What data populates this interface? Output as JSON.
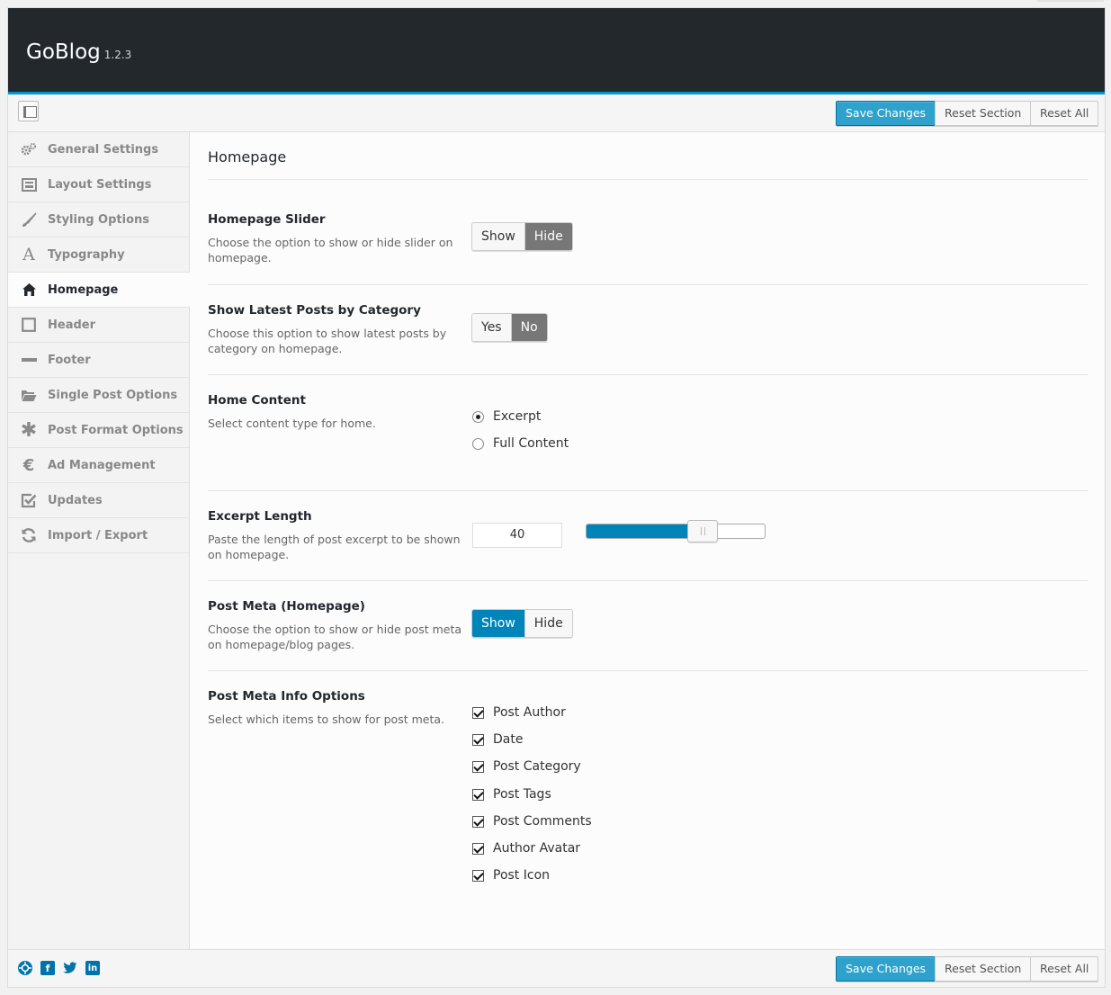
{
  "header": {
    "title": "GoBlog",
    "version": "1.2.3"
  },
  "toolbar": {
    "save_label": "Save Changes",
    "reset_section_label": "Reset Section",
    "reset_all_label": "Reset All"
  },
  "sidebar": {
    "items": [
      {
        "label": "General Settings",
        "icon": "gears-icon"
      },
      {
        "label": "Layout Settings",
        "icon": "layout-icon"
      },
      {
        "label": "Styling Options",
        "icon": "brush-icon"
      },
      {
        "label": "Typography",
        "icon": "font-icon"
      },
      {
        "label": "Homepage",
        "icon": "home-icon"
      },
      {
        "label": "Header",
        "icon": "square-icon"
      },
      {
        "label": "Footer",
        "icon": "minus-icon"
      },
      {
        "label": "Single Post Options",
        "icon": "folder-icon"
      },
      {
        "label": "Post Format Options",
        "icon": "asterisk-icon"
      },
      {
        "label": "Ad Management",
        "icon": "euro-icon"
      },
      {
        "label": "Updates",
        "icon": "checkbox-icon"
      },
      {
        "label": "Import / Export",
        "icon": "refresh-icon"
      }
    ],
    "active": "Homepage"
  },
  "section": {
    "title": "Homepage",
    "slider": {
      "label": "Homepage Slider",
      "desc": "Choose the option to show or hide slider on homepage.",
      "show": "Show",
      "hide": "Hide",
      "selected": "Hide"
    },
    "latest": {
      "label": "Show Latest Posts by Category",
      "desc": "Choose this option to show latest posts by category on homepage.",
      "yes": "Yes",
      "no": "No",
      "selected": "No"
    },
    "content": {
      "label": "Home Content",
      "desc": "Select content type for home.",
      "options": [
        "Excerpt",
        "Full Content"
      ],
      "selected": "Excerpt"
    },
    "excerpt": {
      "label": "Excerpt Length",
      "desc": "Paste the length of post excerpt to be shown on homepage.",
      "value": "40",
      "slider_fraction": 0.65
    },
    "postmeta": {
      "label": "Post Meta (Homepage)",
      "desc": "Choose the option to show or hide post meta on homepage/blog pages.",
      "show": "Show",
      "hide": "Hide",
      "selected": "Show"
    },
    "metainfo": {
      "label": "Post Meta Info Options",
      "desc": "Select which items to show for post meta.",
      "options": [
        "Post Author",
        "Date",
        "Post Category",
        "Post Tags",
        "Post Comments",
        "Author Avatar",
        "Post Icon"
      ]
    }
  },
  "footer": {
    "social": [
      "support-icon",
      "facebook-icon",
      "twitter-icon",
      "linkedin-icon"
    ]
  },
  "colors": {
    "accent": "#0085ba",
    "primary_button": "#2ea2cc",
    "header_bg": "#23282d"
  }
}
